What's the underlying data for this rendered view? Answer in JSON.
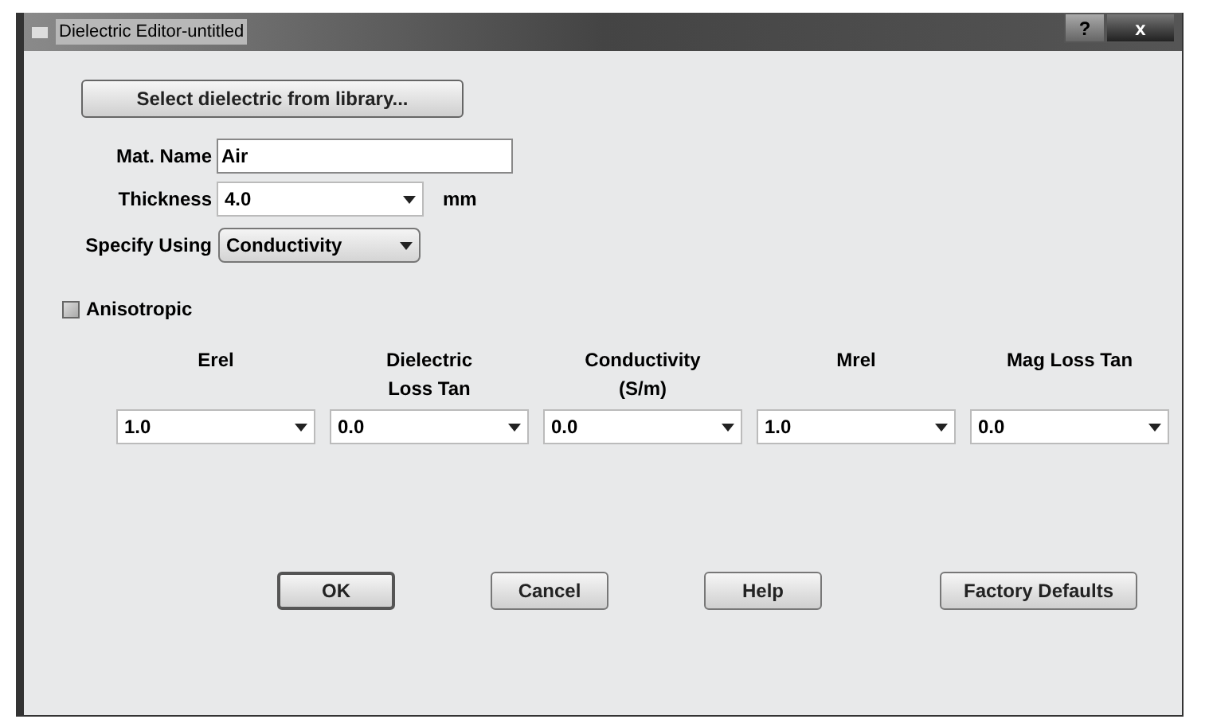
{
  "window": {
    "title": "Dielectric Editor-untitled",
    "title_buttons": [
      {
        "kind": "help",
        "label": "?"
      },
      {
        "kind": "close",
        "label": "x"
      }
    ]
  },
  "library_button": "Select dielectric from library...",
  "mat_name": {
    "label": "Mat. Name",
    "value": "Air"
  },
  "thickness": {
    "label": "Thickness",
    "value": "4.0",
    "unit": "mm"
  },
  "specify_using": {
    "label": "Specify Using",
    "value": "Conductivity"
  },
  "anisotropic": {
    "label": "Anisotropic",
    "checked": false
  },
  "columns": [
    {
      "header": "Erel",
      "value": "1.0"
    },
    {
      "header": "Dielectric\nLoss Tan",
      "value": "0.0"
    },
    {
      "header": "Conductivity\n(S/m)",
      "value": "0.0"
    },
    {
      "header": "Mrel",
      "value": "1.0"
    },
    {
      "header": "Mag Loss Tan",
      "value": "0.0"
    }
  ],
  "buttons": [
    {
      "label": "OK",
      "default": true
    },
    {
      "label": "Cancel",
      "default": false
    },
    {
      "label": "Help",
      "default": false
    },
    {
      "label": "Factory Defaults",
      "default": false
    }
  ]
}
